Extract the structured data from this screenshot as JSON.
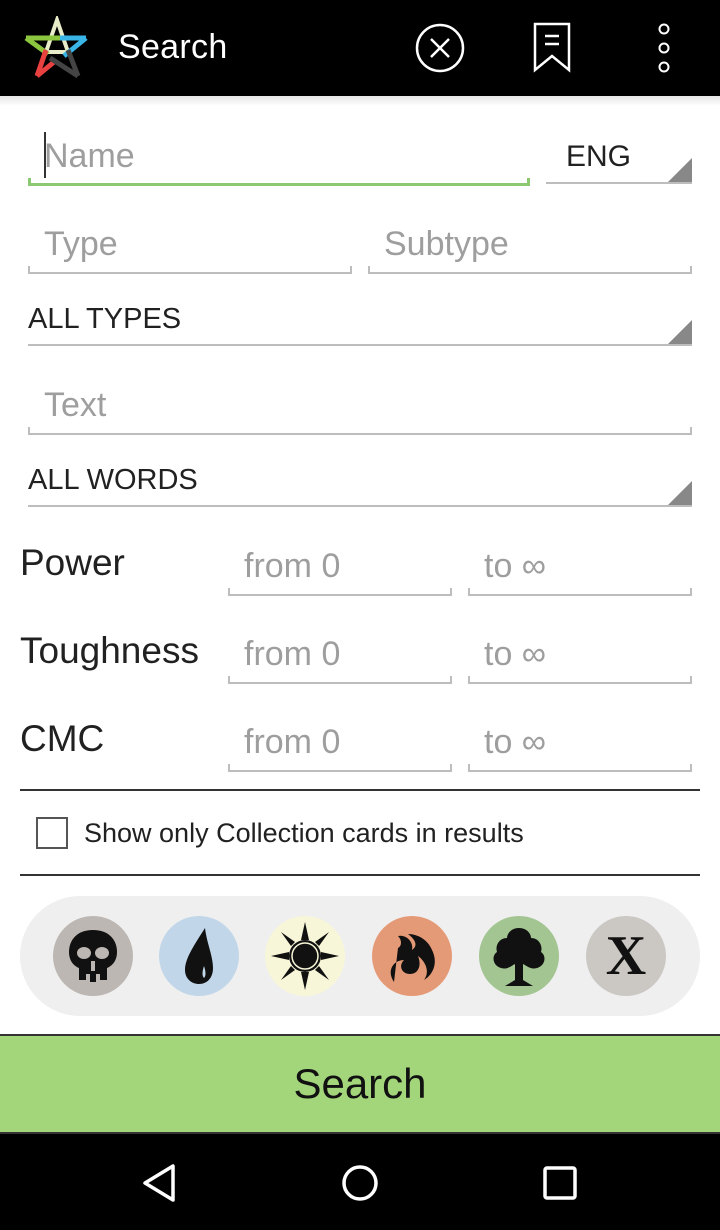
{
  "appbar": {
    "title": "Search",
    "icons": [
      "app-logo-star-icon",
      "clear-circle-x-icon",
      "bookmark-icon",
      "overflow-menu-icon"
    ]
  },
  "form": {
    "name": {
      "placeholder": "Name",
      "value": ""
    },
    "language": {
      "selected": "ENG"
    },
    "type": {
      "placeholder": "Type",
      "value": ""
    },
    "subtype": {
      "placeholder": "Subtype",
      "value": ""
    },
    "type_filter": {
      "selected": "ALL TYPES"
    },
    "text": {
      "placeholder": "Text",
      "value": ""
    },
    "words_filter": {
      "selected": "ALL WORDS"
    },
    "ranges": [
      {
        "label": "Power",
        "from_placeholder": "from 0",
        "to_placeholder": "to ∞"
      },
      {
        "label": "Toughness",
        "from_placeholder": "from 0",
        "to_placeholder": "to ∞"
      },
      {
        "label": "CMC",
        "from_placeholder": "from 0",
        "to_placeholder": "to ∞"
      }
    ],
    "collection_only": {
      "label": "Show only Collection cards in results",
      "checked": false
    }
  },
  "colors": [
    {
      "name": "black",
      "icon": "skull-icon",
      "bg": "#bcb7b2"
    },
    {
      "name": "blue",
      "icon": "water-drop-icon",
      "bg": "#c1d7e9"
    },
    {
      "name": "white",
      "icon": "sun-icon",
      "bg": "#f8f6d8"
    },
    {
      "name": "red",
      "icon": "fire-icon",
      "bg": "#e59a77"
    },
    {
      "name": "green",
      "icon": "tree-icon",
      "bg": "#a2c592"
    },
    {
      "name": "colorless",
      "icon": "x-icon",
      "bg": "#cbc8c4",
      "glyph": "X"
    }
  ],
  "search_button": {
    "label": "Search",
    "color": "#a3d57b"
  },
  "navbar": {
    "icons": [
      "back-icon",
      "home-icon",
      "recents-icon"
    ]
  }
}
